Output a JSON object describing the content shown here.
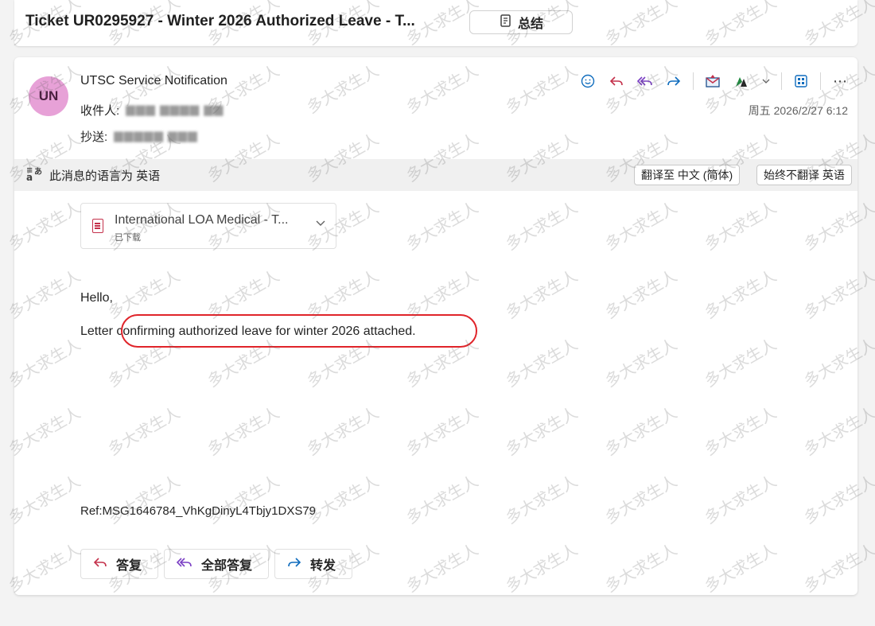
{
  "subject": "Ticket UR0295927 - Winter 2026 Authorized Leave - T...",
  "summary_button": {
    "label": "总结",
    "icon": "summary-icon"
  },
  "message": {
    "avatar_initials": "UN",
    "sender": "UTSC Service Notification",
    "to_label": "收件人:",
    "cc_label": "抄送:",
    "timestamp": "周五 2026/2/27 6:12"
  },
  "toolbar": {
    "icons": [
      "emoji-icon",
      "reply-icon",
      "reply-all-icon",
      "forward-icon",
      "envelope-icon",
      "apps-icon",
      "chevron-down-icon",
      "grid-icon",
      "more-icon"
    ]
  },
  "language_bar": {
    "text": "此消息的语言为 英语",
    "translate_button": "翻译至 中文 (简体)",
    "never_translate_button": "始终不翻译 英语"
  },
  "attachment": {
    "name": "International LOA Medical - T...",
    "status": "已下载"
  },
  "body": {
    "greeting": "Hello,",
    "line1": "Letter confirming authorized leave for winter 2026 attached.",
    "ref": "Ref:MSG1646784_VhKgDinyL4Tbjy1DXS79"
  },
  "actions": {
    "reply": "答复",
    "reply_all": "全部答复",
    "forward": "转发"
  },
  "watermark_text": "多大求生人",
  "colors": {
    "accent": "#0f6cbd",
    "highlight_circle": "#e0242a",
    "avatar": "#e7a1d7"
  }
}
